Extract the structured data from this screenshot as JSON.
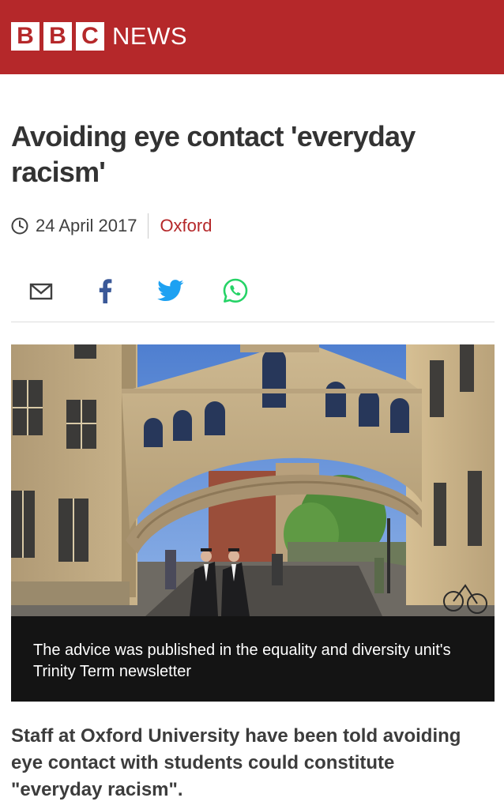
{
  "brand": {
    "logo_letters": [
      "B",
      "B",
      "C"
    ],
    "logo_text": "NEWS",
    "header_color": "#b5282a"
  },
  "article": {
    "headline": "Avoiding eye contact 'everyday racism'",
    "date": "24 April 2017",
    "section": "Oxford",
    "intro": "Staff at Oxford University have been told avoiding eye contact with students could constitute \"everyday racism\"."
  },
  "share": {
    "icons": [
      "email-icon",
      "facebook-icon",
      "twitter-icon",
      "whatsapp-icon"
    ],
    "colors": {
      "facebook": "#3b5998",
      "twitter": "#1da1f2",
      "whatsapp": "#25d366"
    }
  },
  "figure": {
    "image_subject": "bridge-of-sighs-oxford",
    "caption": "The advice was published in the equality and diversity unit's Trinity Term newsletter"
  }
}
